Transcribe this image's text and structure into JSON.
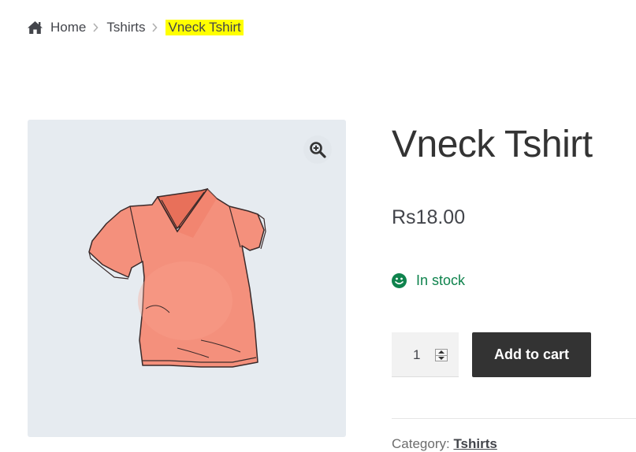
{
  "breadcrumb": {
    "home": "Home",
    "category": "Tshirts",
    "current": "Vneck Tshirt"
  },
  "product": {
    "title": "Vneck Tshirt",
    "price": "Rs18.00",
    "stock_status": "In stock",
    "quantity": "1",
    "add_to_cart_label": "Add to cart",
    "category_label": "Category:",
    "category_value": "Tshirts"
  },
  "icons": {
    "home": "home-icon",
    "zoom": "magnifier-plus-icon",
    "stock": "smiley-icon"
  },
  "colors": {
    "highlight": "#ffff00",
    "stock_green": "#0f834d",
    "button_bg": "#333333",
    "gallery_bg": "#e6ebf0"
  }
}
